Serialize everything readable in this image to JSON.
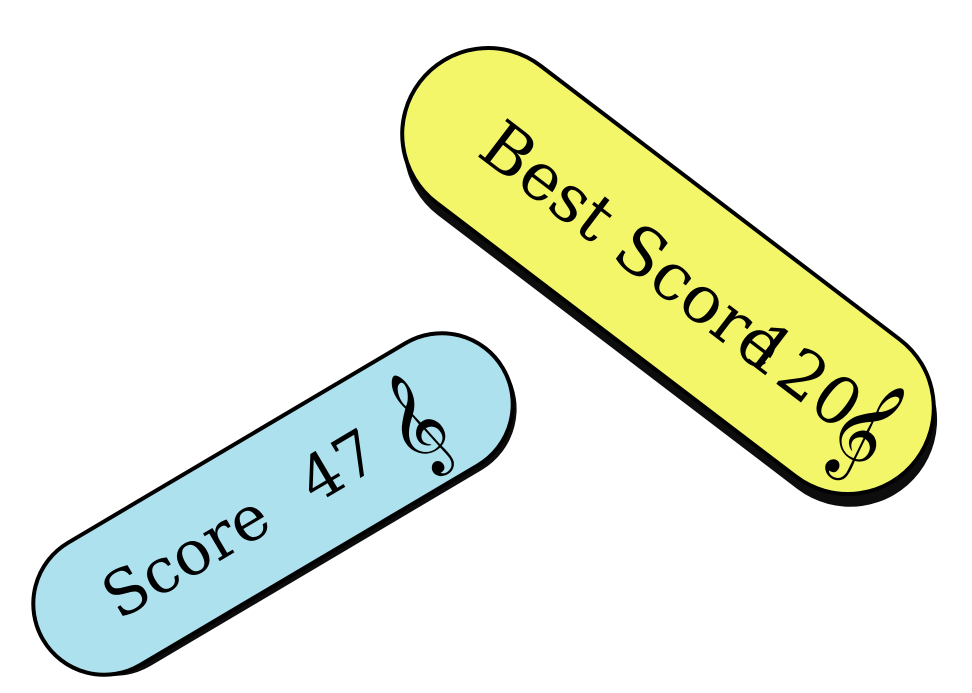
{
  "best_score": {
    "label": "Best Score",
    "value": "120",
    "icon": "treble-clef-icon",
    "color": "#f4f66a"
  },
  "score": {
    "label": "Score",
    "value": "47",
    "icon": "treble-clef-icon",
    "color": "#aee1ee"
  },
  "icons": {
    "treble_clef": "𝄞"
  },
  "colors": {
    "outline": "#000000",
    "shadow": "#000000",
    "background": "#ffffff"
  }
}
